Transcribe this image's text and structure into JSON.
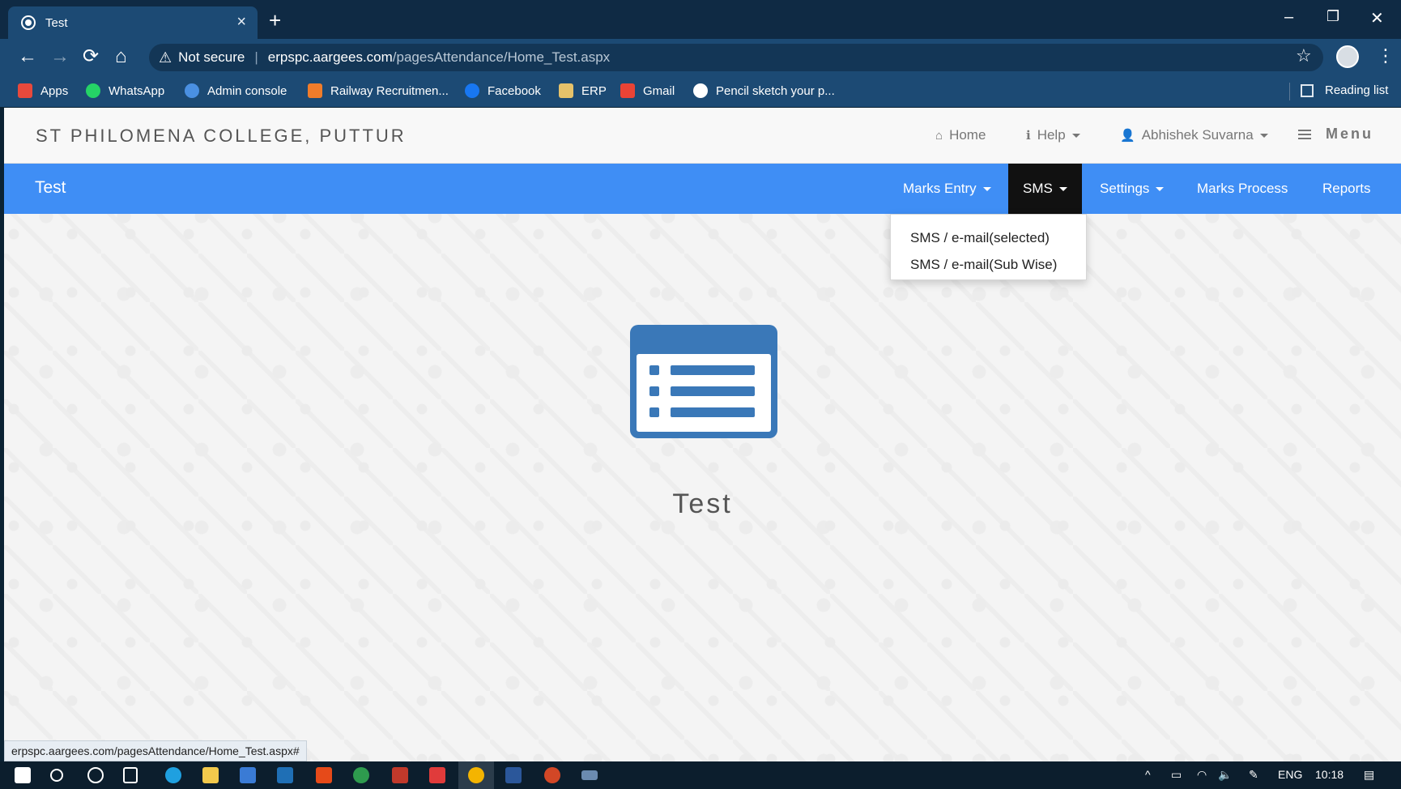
{
  "browser": {
    "tab_title": "Test",
    "tab_close": "×",
    "new_tab": "+",
    "window_controls": {
      "minimize": "–",
      "restore": "❐",
      "close": "✕"
    },
    "nav": {
      "back": "←",
      "forward": "→",
      "reload": "⟳",
      "home": "⌂"
    },
    "security_label": "Not secure",
    "url_host": "erpspc.aargees.com",
    "url_path": "/pagesAttendance/Home_Test.aspx",
    "star": "☆",
    "more": "⋮",
    "bookmarks": [
      {
        "label": "Apps",
        "icon": "apps-grid-icon",
        "color": "#e8493c"
      },
      {
        "label": "WhatsApp",
        "icon": "whatsapp-icon",
        "color": "#25d366"
      },
      {
        "label": "Admin console",
        "icon": "admin-console-icon",
        "color": "#4a90e2"
      },
      {
        "label": "Railway Recruitmen...",
        "icon": "railway-icon",
        "color": "#f07c2a"
      },
      {
        "label": "Facebook",
        "icon": "facebook-icon",
        "color": "#1877f2"
      },
      {
        "label": "ERP",
        "icon": "erp-icon",
        "color": "#e6c26a"
      },
      {
        "label": "Gmail",
        "icon": "gmail-icon",
        "color": "#ea4335"
      },
      {
        "label": "Pencil sketch your p...",
        "icon": "globe-icon",
        "color": "#ffffff"
      }
    ],
    "reading_list": "Reading list"
  },
  "site": {
    "college_name": "ST PHILOMENA COLLEGE, PUTTUR",
    "top_nav": {
      "home": "Home",
      "help": "Help",
      "user": "Abhishek Suvarna",
      "menu": "Menu"
    },
    "module_title": "Test",
    "main_nav": {
      "marks_entry": "Marks Entry",
      "sms": "SMS",
      "settings": "Settings",
      "marks_process": "Marks Process",
      "reports": "Reports"
    },
    "sms_dropdown": {
      "item1": "SMS / e-mail(selected)",
      "item2": "SMS / e-mail(Sub Wise)"
    },
    "page_heading": "Test"
  },
  "status_bar_url": "erpspc.aargees.com/pagesAttendance/Home_Test.aspx#",
  "taskbar": {
    "language": "ENG",
    "time": "10:18",
    "tray_up": "^"
  },
  "colors": {
    "nav_blue": "#3f8ef5",
    "active_tab": "#111111",
    "icon_blue": "#3a78b8"
  }
}
